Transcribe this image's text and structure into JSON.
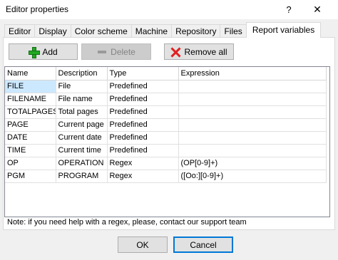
{
  "window": {
    "title": "Editor properties",
    "help_label": "?",
    "close_label": "✕"
  },
  "tabs": [
    {
      "label": "Editor",
      "active": false
    },
    {
      "label": "Display",
      "active": false
    },
    {
      "label": "Color scheme",
      "active": false
    },
    {
      "label": "Machine",
      "active": false
    },
    {
      "label": "Repository",
      "active": false
    },
    {
      "label": "Files",
      "active": false
    },
    {
      "label": "Report variables",
      "active": true
    }
  ],
  "toolbar": {
    "add_label": "Add",
    "delete_label": "Delete",
    "remove_all_label": "Remove all",
    "add_icon": "plus-icon",
    "delete_icon": "minus-icon",
    "remove_all_icon": "x-icon"
  },
  "table": {
    "columns": [
      "Name",
      "Description",
      "Type",
      "Expression"
    ],
    "rows": [
      [
        "FILE",
        "File",
        "Predefined",
        ""
      ],
      [
        "FILENAME",
        "File name",
        "Predefined",
        ""
      ],
      [
        "TOTALPAGES",
        "Total pages",
        "Predefined",
        ""
      ],
      [
        "PAGE",
        "Current page",
        "Predefined",
        ""
      ],
      [
        "DATE",
        "Current date",
        "Predefined",
        ""
      ],
      [
        "TIME",
        "Current time",
        "Predefined",
        ""
      ],
      [
        "OP",
        "OPERATION",
        "Regex",
        "(OP[0-9]+)"
      ],
      [
        "PGM",
        "PROGRAM",
        "Regex",
        "([Oo:][0-9]+)"
      ]
    ]
  },
  "note": "Note: if you need help with a regex, please, contact our support team",
  "footer": {
    "ok_label": "OK",
    "cancel_label": "Cancel"
  },
  "colors": {
    "selection": "#cce8ff",
    "default_button_border": "#0078d7",
    "add_icon": "#22a822",
    "remove_icon": "#e02020"
  }
}
